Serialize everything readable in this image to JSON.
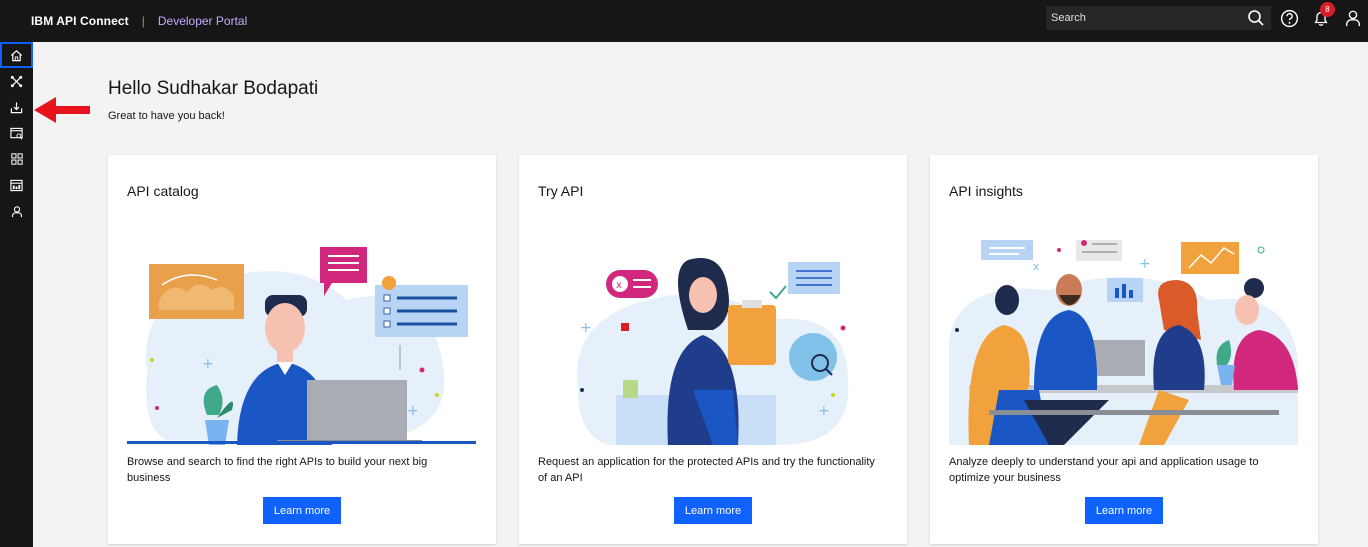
{
  "header": {
    "brand": "IBM API Connect",
    "separator": "|",
    "portal": "Developer Portal",
    "search_placeholder": "Search",
    "notifications_count": "8"
  },
  "sidebar": {
    "items": [
      {
        "name": "home",
        "icon": "home-icon",
        "active": true
      },
      {
        "name": "apis",
        "icon": "api-network-icon"
      },
      {
        "name": "consume",
        "icon": "download-tray-icon"
      },
      {
        "name": "explore",
        "icon": "window-search-icon"
      },
      {
        "name": "apps",
        "icon": "grid-apps-icon"
      },
      {
        "name": "analytics",
        "icon": "calendar-chart-icon"
      },
      {
        "name": "profile",
        "icon": "user-icon"
      }
    ]
  },
  "main": {
    "greeting": "Hello Sudhakar Bodapati",
    "welcome": "Great to have you back!",
    "cards": [
      {
        "title": "API catalog",
        "description": "Browse and search to find the right APIs to build your next big business",
        "button": "Learn more"
      },
      {
        "title": "Try API",
        "description": "Request an application for the protected APIs and try the functionality of an API",
        "button": "Learn more"
      },
      {
        "title": "API insights",
        "description": "Analyze deeply to understand your api and application usage to optimize your business",
        "button": "Learn more"
      }
    ]
  },
  "colors": {
    "topbar": "#161616",
    "accent": "#0f62fe",
    "portal": "#c7a8ff",
    "annotation_arrow": "#e8141b"
  }
}
